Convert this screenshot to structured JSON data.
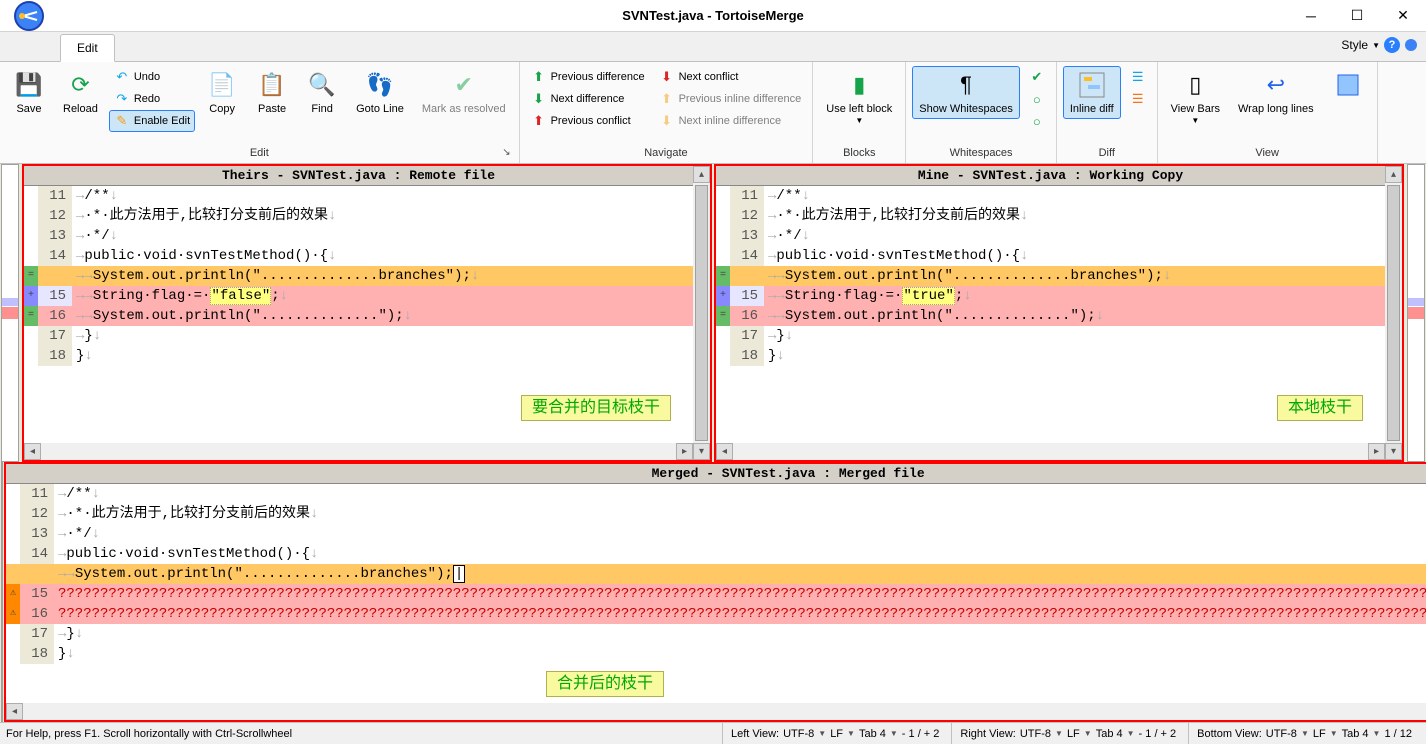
{
  "window": {
    "title": "SVNTest.java - TortoiseMerge"
  },
  "tabstrip": {
    "edit": "Edit",
    "style": "Style"
  },
  "ribbon": {
    "save": "Save",
    "reload": "Reload",
    "undo": "Undo",
    "redo": "Redo",
    "enable_edit": "Enable Edit",
    "copy": "Copy",
    "paste": "Paste",
    "find": "Find",
    "goto": "Goto Line",
    "mark_resolved": "Mark as resolved",
    "prev_diff": "Previous difference",
    "next_diff": "Next difference",
    "prev_conflict": "Previous conflict",
    "next_conflict": "Next conflict",
    "prev_inline": "Previous inline difference",
    "next_inline": "Next inline difference",
    "use_left": "Use left block",
    "show_ws": "Show Whitespaces",
    "inline_diff": "Inline diff",
    "view_bars": "View Bars",
    "wrap": "Wrap long lines",
    "group_edit": "Edit",
    "group_navigate": "Navigate",
    "group_blocks": "Blocks",
    "group_ws": "Whitespaces",
    "group_diff": "Diff",
    "group_view": "View"
  },
  "panes": {
    "theirs_header": "Theirs - SVNTest.java : Remote file",
    "mine_header": "Mine - SVNTest.java : Working Copy",
    "merged_header": "Merged - SVNTest.java : Merged file",
    "theirs_flag": "\"false\"",
    "mine_flag": "\"true\"",
    "annotation_theirs": "要合并的目标枝干",
    "annotation_mine": "本地枝干",
    "annotation_merged": "合并后的枝干",
    "line_comment1": "/**",
    "line_comment2": "·*·此方法用于,比较打分支前后的效果",
    "line_comment3": "·*/",
    "line_method": "public·void·svnTestMethod()·{",
    "line_out_br": "System.out.println(\"..............branches\");",
    "line_string_pre": "String·flag·=·",
    "line_out_pl": "System.out.println(\"..............\");",
    "line_close": "}",
    "line_close2": "}",
    "line_qmarks": "????????????????????????????????????????????????????????????????????????????????????????????????????????????????????????????????????????????????????????????????????????????????????"
  },
  "status": {
    "help": "For Help, press F1. Scroll horizontally with Ctrl-Scrollwheel",
    "left_label": "Left View:",
    "right_label": "Right View:",
    "bottom_label": "Bottom View:",
    "enc": "UTF-8",
    "eol": "LF",
    "tab": "Tab 4",
    "diff": "- 1 / + 2",
    "pos": "1 / 12"
  }
}
